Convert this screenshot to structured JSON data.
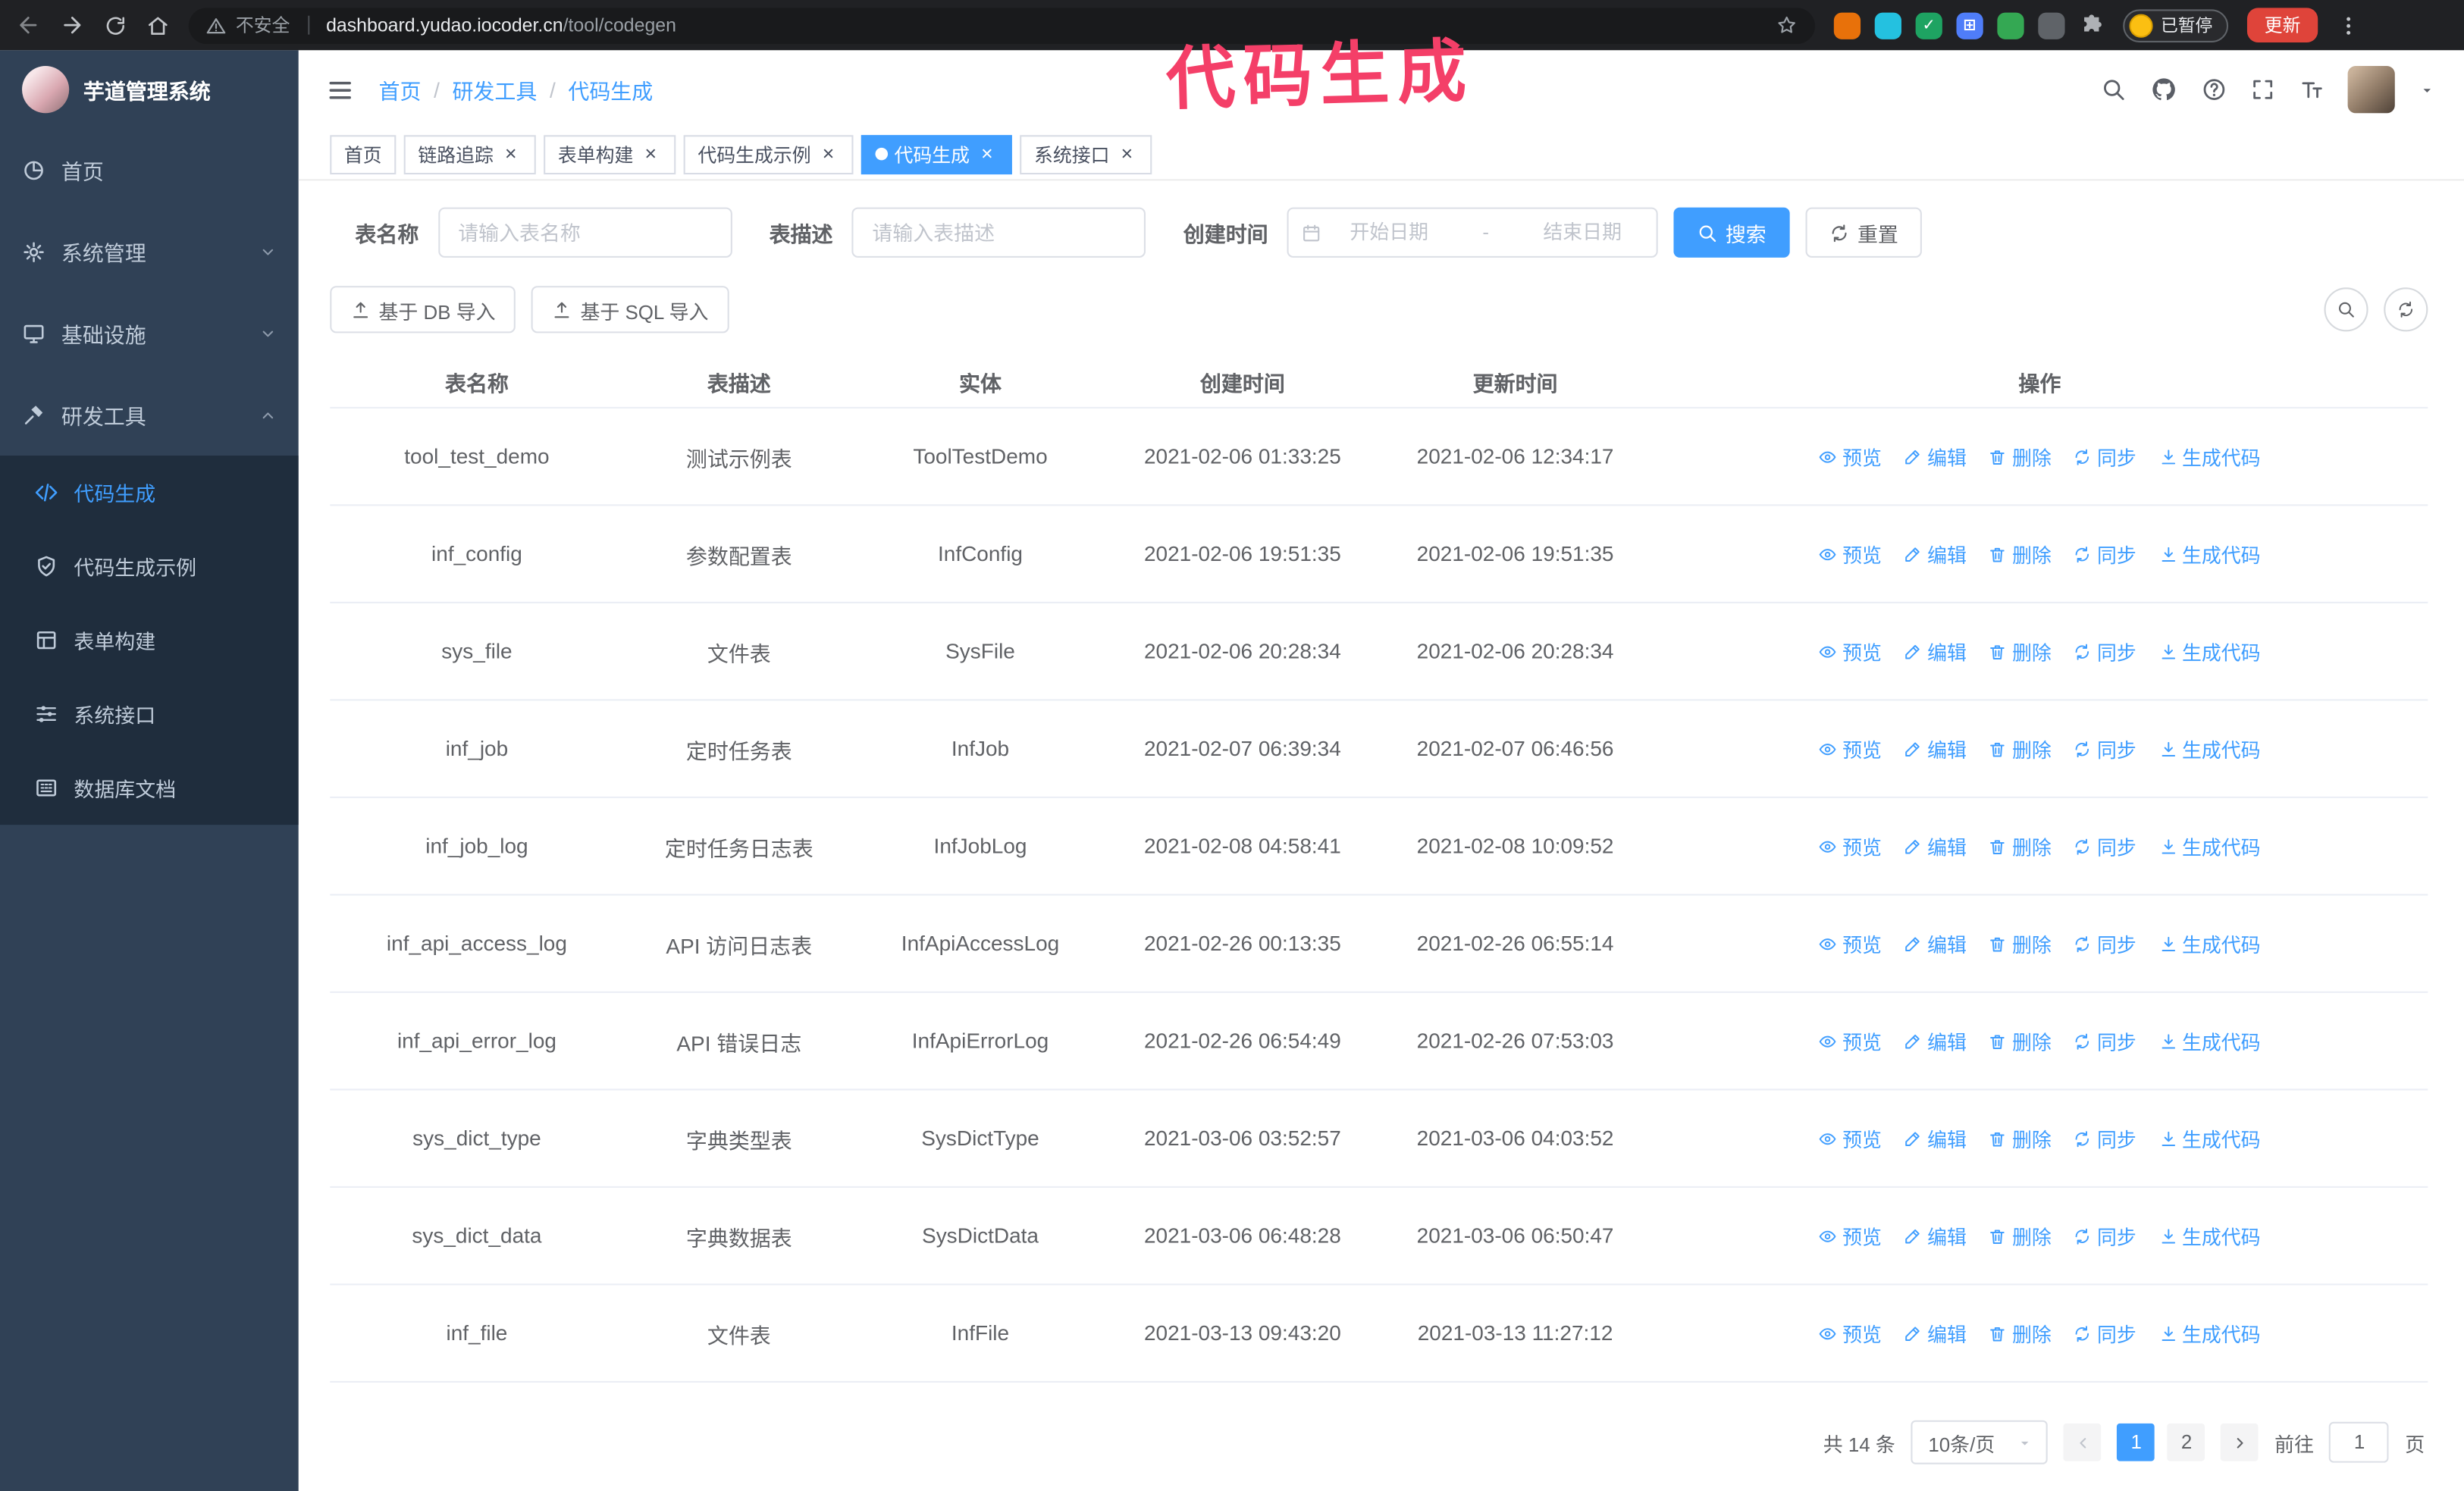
{
  "annotation": "代码生成",
  "colors": {
    "accent": "#409eff",
    "sidebar_bg": "#304156",
    "submenu_bg": "#1f2d3d",
    "annotation": "#f43f68",
    "update_button": "#df443a"
  },
  "browser": {
    "security_label": "不安全",
    "url_host": "dashboard.yudao.iocoder.cn",
    "url_path": "/tool/codegen",
    "paused_badge": "已暂停",
    "update_button": "更新",
    "extensions": [
      {
        "name": "extension-orange-icon",
        "color": "#e8710a",
        "glyph": ""
      },
      {
        "name": "extension-teal-icon",
        "color": "#24c1e0",
        "glyph": ""
      },
      {
        "name": "extension-green-check-icon",
        "color": "#1ea362",
        "glyph": "✓"
      },
      {
        "name": "extension-blue-grid-icon",
        "color": "#4f7df9",
        "glyph": "⊞"
      },
      {
        "name": "extension-green-icon",
        "color": "#34a853",
        "glyph": ""
      },
      {
        "name": "extension-dark-icon",
        "color": "#5f6368",
        "glyph": ""
      }
    ]
  },
  "sidebar": {
    "logo_title": "芋道管理系统",
    "items": [
      {
        "label": "首页",
        "icon": "dashboard-icon"
      },
      {
        "label": "系统管理",
        "icon": "gear-icon",
        "chevron": "down"
      },
      {
        "label": "基础设施",
        "icon": "infrastructure-icon",
        "chevron": "down"
      },
      {
        "label": "研发工具",
        "icon": "tools-icon",
        "chevron": "up",
        "expanded": true
      }
    ],
    "subitems": [
      {
        "label": "代码生成",
        "icon": "code-icon",
        "active": true
      },
      {
        "label": "代码生成示例",
        "icon": "example-icon"
      },
      {
        "label": "表单构建",
        "icon": "form-icon"
      },
      {
        "label": "系统接口",
        "icon": "api-icon"
      },
      {
        "label": "数据库文档",
        "icon": "database-icon"
      }
    ]
  },
  "header": {
    "breadcrumb": [
      "首页",
      "研发工具",
      "代码生成"
    ]
  },
  "tabs": [
    {
      "label": "首页",
      "closable": false
    },
    {
      "label": "链路追踪",
      "closable": true
    },
    {
      "label": "表单构建",
      "closable": true
    },
    {
      "label": "代码生成示例",
      "closable": true
    },
    {
      "label": "代码生成",
      "closable": true,
      "active": true
    },
    {
      "label": "系统接口",
      "closable": true
    }
  ],
  "filters": {
    "table_name_label": "表名称",
    "table_name_placeholder": "请输入表名称",
    "table_desc_label": "表描述",
    "table_desc_placeholder": "请输入表描述",
    "create_time_label": "创建时间",
    "start_placeholder": "开始日期",
    "range_sep": "-",
    "end_placeholder": "结束日期",
    "search_button": "搜索",
    "reset_button": "重置"
  },
  "toolbar": {
    "import_db": "基于 DB 导入",
    "import_sql": "基于 SQL 导入"
  },
  "table": {
    "columns": [
      "表名称",
      "表描述",
      "实体",
      "创建时间",
      "更新时间",
      "操作"
    ],
    "row_actions": [
      {
        "label": "预览",
        "name": "preview",
        "icon": "eye-icon"
      },
      {
        "label": "编辑",
        "name": "edit",
        "icon": "edit-icon"
      },
      {
        "label": "删除",
        "name": "delete",
        "icon": "trash-icon"
      },
      {
        "label": "同步",
        "name": "sync",
        "icon": "sync-icon"
      },
      {
        "label": "生成代码",
        "name": "generate-code",
        "icon": "download-icon"
      }
    ],
    "rows": [
      {
        "name": "tool_test_demo",
        "desc": "测试示例表",
        "entity": "ToolTestDemo",
        "created": "2021-02-06 01:33:25",
        "updated": "2021-02-06 12:34:17"
      },
      {
        "name": "inf_config",
        "desc": "参数配置表",
        "entity": "InfConfig",
        "created": "2021-02-06 19:51:35",
        "updated": "2021-02-06 19:51:35"
      },
      {
        "name": "sys_file",
        "desc": "文件表",
        "entity": "SysFile",
        "created": "2021-02-06 20:28:34",
        "updated": "2021-02-06 20:28:34"
      },
      {
        "name": "inf_job",
        "desc": "定时任务表",
        "entity": "InfJob",
        "created": "2021-02-07 06:39:34",
        "updated": "2021-02-07 06:46:56"
      },
      {
        "name": "inf_job_log",
        "desc": "定时任务日志表",
        "entity": "InfJobLog",
        "created": "2021-02-08 04:58:41",
        "updated": "2021-02-08 10:09:52"
      },
      {
        "name": "inf_api_access_log",
        "desc": "API 访问日志表",
        "entity": "InfApiAccessLog",
        "created": "2021-02-26 00:13:35",
        "updated": "2021-02-26 06:55:14"
      },
      {
        "name": "inf_api_error_log",
        "desc": "API 错误日志",
        "entity": "InfApiErrorLog",
        "created": "2021-02-26 06:54:49",
        "updated": "2021-02-26 07:53:03"
      },
      {
        "name": "sys_dict_type",
        "desc": "字典类型表",
        "entity": "SysDictType",
        "created": "2021-03-06 03:52:57",
        "updated": "2021-03-06 04:03:52"
      },
      {
        "name": "sys_dict_data",
        "desc": "字典数据表",
        "entity": "SysDictData",
        "created": "2021-03-06 06:48:28",
        "updated": "2021-03-06 06:50:47"
      },
      {
        "name": "inf_file",
        "desc": "文件表",
        "entity": "InfFile",
        "created": "2021-03-13 09:43:20",
        "updated": "2021-03-13 11:27:12"
      }
    ]
  },
  "pagination": {
    "total": "共 14 条",
    "page_size": "10条/页",
    "pages": [
      {
        "label": "1",
        "active": true
      },
      {
        "label": "2"
      }
    ],
    "goto_label": "前往",
    "goto_value": "1",
    "goto_suffix": "页"
  }
}
